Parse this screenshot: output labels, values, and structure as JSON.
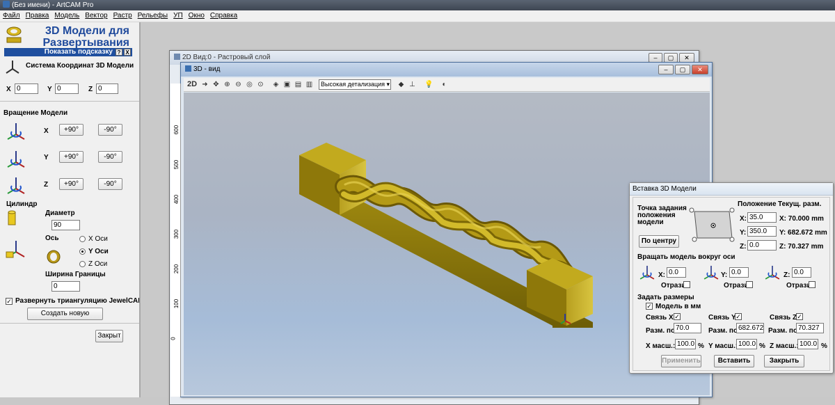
{
  "window": {
    "title": "(Без имени) - ArtCAM Pro"
  },
  "menu": [
    "Файл",
    "Правка",
    "Модель",
    "Вектор",
    "Растр",
    "Рельефы",
    "УП",
    "Окно",
    "Справка"
  ],
  "panel": {
    "title_line1": "3D Модели для",
    "title_line2": "Развертывания",
    "hint_label": "Показать подсказку",
    "hint_q": "?",
    "hint_x": "X",
    "coord_title": "Система Координат 3D Модели",
    "x_label": "X",
    "x_value": "0",
    "y_label": "Y",
    "y_value": "0",
    "z_label": "Z",
    "z_value": "0",
    "rotation_title": "Вращение Модели",
    "rot_x": "X",
    "rot_y": "Y",
    "rot_z": "Z",
    "plus90": "+90°",
    "minus90": "-90°",
    "cylinder_title": "Цилиндр",
    "diameter_label": "Диаметр",
    "diameter_value": "90",
    "axis_label": "Ось",
    "axis_options": [
      "X Оси",
      "Y Оси",
      "Z Оси"
    ],
    "axis_selected": "Y Оси",
    "border_label": "Ширина Границы",
    "border_value": "0",
    "jewelcad_label": "Развернуть триангуляцию JewelCAD",
    "jewelcad_checked": "✓",
    "create_new": "Создать новую",
    "close": "Закрыт"
  },
  "win2d": {
    "title": "2D Вид:0 - Растровый слой",
    "ruler_ticks": [
      "600",
      "500",
      "400",
      "300",
      "200",
      "100",
      "0"
    ]
  },
  "win3d": {
    "title": "3D - вид",
    "btn_2d": "2D",
    "detail_select": "Высокая детализация"
  },
  "insert": {
    "title": "Вставка 3D Модели",
    "anchor_label_1": "Точка задания",
    "anchor_label_2": "положения",
    "anchor_label_3": "модели",
    "position_header": "Положение",
    "current_size_header": "Текущ. разм.",
    "pos_x_label": "X:",
    "pos_x": "35.0",
    "size_x": "X: 70.000 mm",
    "pos_y_label": "Y:",
    "pos_y": "350.0",
    "size_y": "Y: 682.672 mm",
    "pos_z_label": "Z:",
    "pos_z": "0.0",
    "size_z": "Z: 70.327 mm",
    "center_btn": "По центру",
    "rotate_title": "Вращать модель вокруг оси",
    "rot_x_label": "X:",
    "rot_x": "0.0",
    "rot_y_label": "Y:",
    "rot_y": "0.0",
    "rot_z_label": "Z:",
    "rot_z": "0.0",
    "mirror_label": "Отрази",
    "size_title": "Задать размеры",
    "model_mm_label": "Модель в мм",
    "check": "✓",
    "link_x": "Связь X:",
    "link_y": "Связь Y:",
    "link_z": "Связь Z:",
    "size_by": "Разм. по",
    "size_x_val": "70.0",
    "size_y_val": "682.672",
    "size_z_val": "70.327",
    "scale_x_label": "X масш.:",
    "scale_y_label": "Y масш.:",
    "scale_z_label": "Z масш.:",
    "scale_x": "100.0",
    "scale_y": "100.0",
    "scale_z": "100.0",
    "percent": "%",
    "apply_btn": "Применить",
    "insert_btn": "Вставить",
    "close_btn": "Закрыть"
  },
  "colors": {
    "accent": "#1f4f9f",
    "model": "#a08a10",
    "title_blue": "#1f4a9c"
  }
}
